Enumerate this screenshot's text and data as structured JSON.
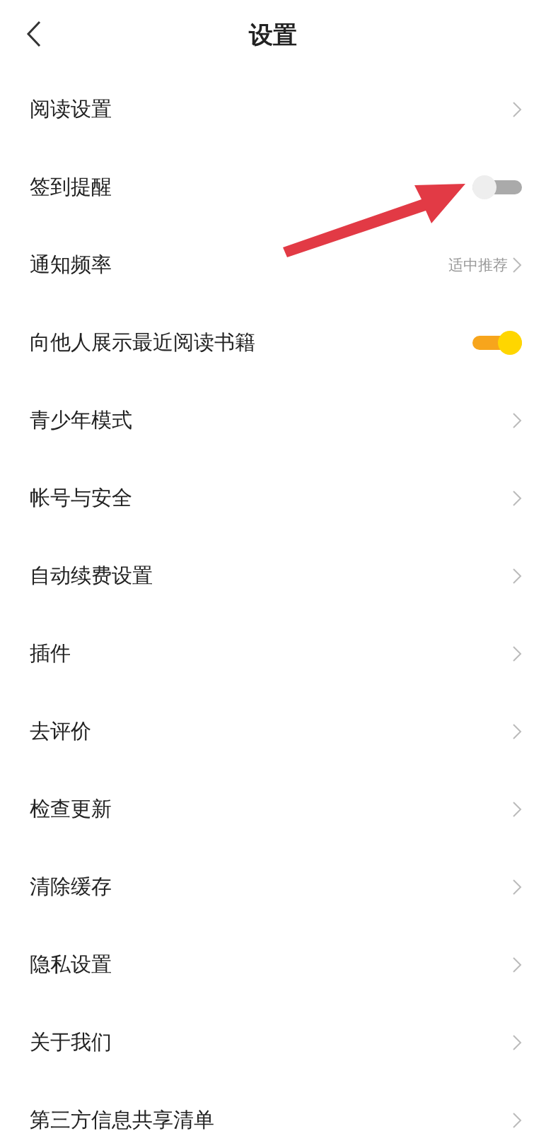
{
  "header": {
    "title": "设置"
  },
  "rows": [
    {
      "kind": "link",
      "label": "阅读设置"
    },
    {
      "kind": "toggle",
      "label": "签到提醒",
      "on": false
    },
    {
      "kind": "link",
      "label": "通知频率",
      "value": "适中推荐"
    },
    {
      "kind": "toggle",
      "label": "向他人展示最近阅读书籍",
      "on": true
    },
    {
      "kind": "link",
      "label": "青少年模式"
    },
    {
      "kind": "link",
      "label": "帐号与安全"
    },
    {
      "kind": "link",
      "label": "自动续费设置"
    },
    {
      "kind": "link",
      "label": "插件"
    },
    {
      "kind": "link",
      "label": "去评价"
    },
    {
      "kind": "link",
      "label": "检查更新"
    },
    {
      "kind": "link",
      "label": "清除缓存"
    },
    {
      "kind": "link",
      "label": "隐私设置"
    },
    {
      "kind": "link",
      "label": "关于我们"
    },
    {
      "kind": "link",
      "label": "第三方信息共享清单"
    }
  ]
}
